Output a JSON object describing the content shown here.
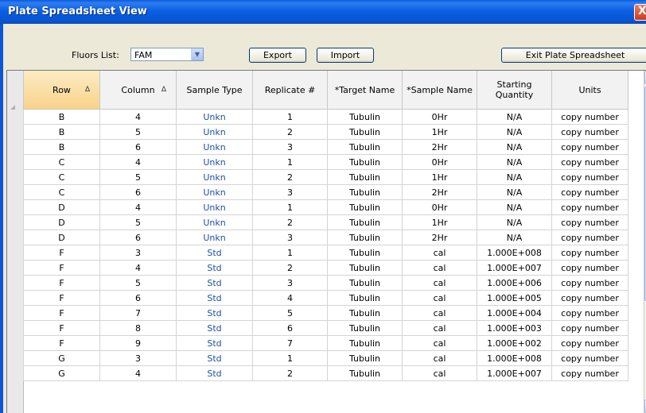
{
  "window": {
    "title": "Plate Spreadsheet View",
    "close_glyph": "X"
  },
  "toolbar": {
    "fluors_label": "Fluors List:",
    "fluors_value": "FAM",
    "export_label": "Export",
    "import_label": "Import",
    "exit_label": "Exit Plate Spreadsheet"
  },
  "columns": [
    "Row",
    "Column",
    "Sample Type",
    "Replicate #",
    "*Target Name",
    "*Sample Name",
    "Starting Quantity",
    "Units"
  ],
  "rows": [
    [
      "B",
      "4",
      "Unkn",
      "1",
      "Tubulin",
      "0Hr",
      "N/A",
      "copy number"
    ],
    [
      "B",
      "5",
      "Unkn",
      "2",
      "Tubulin",
      "1Hr",
      "N/A",
      "copy number"
    ],
    [
      "B",
      "6",
      "Unkn",
      "3",
      "Tubulin",
      "2Hr",
      "N/A",
      "copy number"
    ],
    [
      "C",
      "4",
      "Unkn",
      "1",
      "Tubulin",
      "0Hr",
      "N/A",
      "copy number"
    ],
    [
      "C",
      "5",
      "Unkn",
      "2",
      "Tubulin",
      "1Hr",
      "N/A",
      "copy number"
    ],
    [
      "C",
      "6",
      "Unkn",
      "3",
      "Tubulin",
      "2Hr",
      "N/A",
      "copy number"
    ],
    [
      "D",
      "4",
      "Unkn",
      "1",
      "Tubulin",
      "0Hr",
      "N/A",
      "copy number"
    ],
    [
      "D",
      "5",
      "Unkn",
      "2",
      "Tubulin",
      "1Hr",
      "N/A",
      "copy number"
    ],
    [
      "D",
      "6",
      "Unkn",
      "3",
      "Tubulin",
      "2Hr",
      "N/A",
      "copy number"
    ],
    [
      "F",
      "3",
      "Std",
      "1",
      "Tubulin",
      "cal",
      "1.000E+008",
      "copy number"
    ],
    [
      "F",
      "4",
      "Std",
      "2",
      "Tubulin",
      "cal",
      "1.000E+007",
      "copy number"
    ],
    [
      "F",
      "5",
      "Std",
      "3",
      "Tubulin",
      "cal",
      "1.000E+006",
      "copy number"
    ],
    [
      "F",
      "6",
      "Std",
      "4",
      "Tubulin",
      "cal",
      "1.000E+005",
      "copy number"
    ],
    [
      "F",
      "7",
      "Std",
      "5",
      "Tubulin",
      "cal",
      "1.000E+004",
      "copy number"
    ],
    [
      "F",
      "8",
      "Std",
      "6",
      "Tubulin",
      "cal",
      "1.000E+003",
      "copy number"
    ],
    [
      "F",
      "9",
      "Std",
      "7",
      "Tubulin",
      "cal",
      "1.000E+002",
      "copy number"
    ],
    [
      "G",
      "3",
      "Std",
      "1",
      "Tubulin",
      "cal",
      "1.000E+008",
      "copy number"
    ],
    [
      "G",
      "4",
      "Std",
      "2",
      "Tubulin",
      "cal",
      "1.000E+007",
      "copy number"
    ]
  ],
  "icons": {
    "sort": "sort-ascending-icon",
    "dropdown": "chevron-down-icon",
    "close": "close-icon"
  },
  "colors": {
    "titlebar": "#0a5bd8",
    "sample_type_text": "#1f4fa3",
    "sorted_header": "#f8d38a"
  }
}
